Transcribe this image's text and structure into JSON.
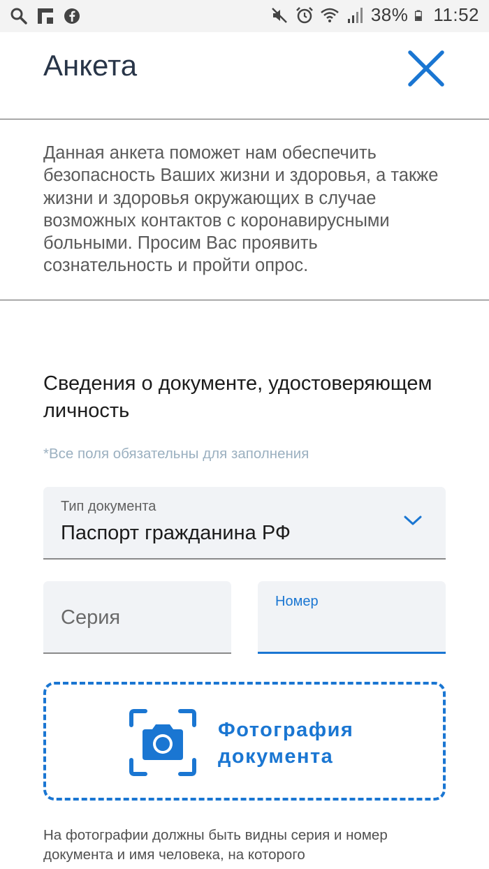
{
  "status_bar": {
    "battery": "38%",
    "time": "11:52",
    "left_icons": [
      "search-icon",
      "flipboard-icon",
      "facebook-icon"
    ],
    "right_icons": [
      "mute-icon",
      "alarm-icon",
      "wifi-icon",
      "signal-icon",
      "battery-icon"
    ]
  },
  "header": {
    "title": "Анкета",
    "close_icon": "close-icon"
  },
  "intro": {
    "text": "Данная анкета поможет нам обеспечить безопасность Ваших жизни и здоровья, а также жизни и здоровья окружающих в случае возможных контактов с коронавирусными больными. Просим Вас проявить сознательность и пройти опрос."
  },
  "section": {
    "title": "Сведения о документе, удостоверяющем личность",
    "required_note": "*Все поля обязательны для заполнения"
  },
  "form": {
    "doc_type": {
      "label": "Тип документа",
      "value": "Паспорт гражданина РФ"
    },
    "series": {
      "placeholder": "Серия"
    },
    "number": {
      "label": "Номер",
      "value": ""
    }
  },
  "photo": {
    "label": "Фотография документа",
    "icon": "camera-icon",
    "hint": "На фотографии должны быть видны серия и номер документа и имя человека, на которого"
  },
  "colors": {
    "accent": "#1a76d2",
    "title": "#283548",
    "field_bg": "#f1f3f6"
  }
}
